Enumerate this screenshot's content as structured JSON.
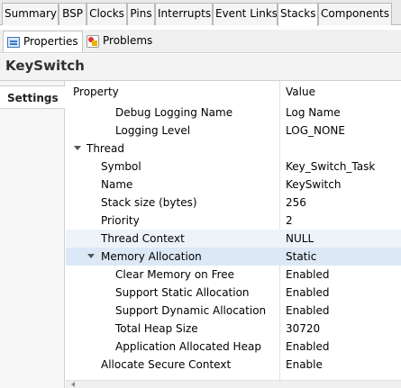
{
  "tabs": [
    "Summary",
    "BSP",
    "Clocks",
    "Pins",
    "Interrupts",
    "Event Links",
    "Stacks",
    "Components"
  ],
  "active_tab": "Stacks",
  "subtabs": [
    "Properties",
    "Problems"
  ],
  "title": "KeySwitch",
  "left_tab": "Settings",
  "table": {
    "header_property": "Property",
    "header_value": "Value",
    "rows": [
      {
        "property": "Debug Logging Name",
        "value": "Log Name"
      },
      {
        "property": "Logging Level",
        "value": "LOG_NONE"
      },
      {
        "property": "Thread",
        "value": ""
      },
      {
        "property": "Symbol",
        "value": "Key_Switch_Task"
      },
      {
        "property": "Name",
        "value": "KeySwitch"
      },
      {
        "property": "Stack size (bytes)",
        "value": "256"
      },
      {
        "property": "Priority",
        "value": "2"
      },
      {
        "property": "Thread Context",
        "value": "NULL"
      },
      {
        "property": "Memory Allocation",
        "value": "Static"
      },
      {
        "property": "Clear Memory on Free",
        "value": "Enabled"
      },
      {
        "property": "Support Static Allocation",
        "value": "Enabled"
      },
      {
        "property": "Support Dynamic Allocation",
        "value": "Enabled"
      },
      {
        "property": "Total Heap Size",
        "value": "30720"
      },
      {
        "property": "Application Allocated Heap",
        "value": "Enabled"
      },
      {
        "property": "Allocate Secure Context",
        "value": "Enable"
      }
    ]
  }
}
